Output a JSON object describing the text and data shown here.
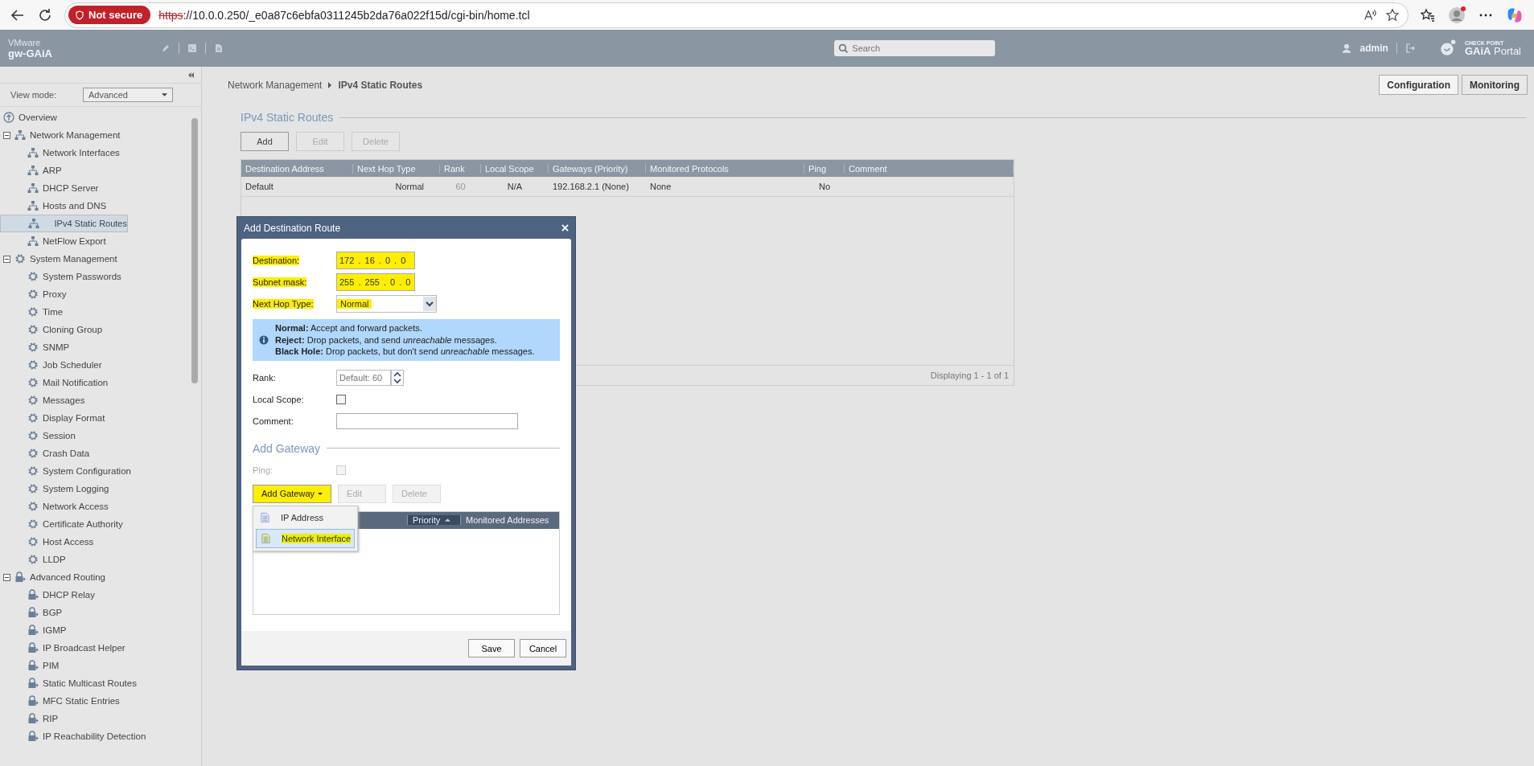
{
  "browser": {
    "security_label": "Not secure",
    "url_scheme": "https",
    "url_rest": "://10.0.0.250/_e0a87c6ebfa0311245b2da76a022f15d/cgi-bin/home.tcl"
  },
  "header": {
    "vendor": "VMware",
    "host": "gw-GAiA",
    "search": {
      "placeholder": "Search"
    },
    "user": "admin",
    "brand_small": "CHECK POINT",
    "brand": "**GAiA** Portal"
  },
  "sidebar": {
    "view_mode_label": "View mode:",
    "view_mode_value": "Advanced",
    "items": [
      {
        "label": "Overview",
        "kind": "overview",
        "selected": false
      },
      {
        "label": "Network Management",
        "kind": "network",
        "selected": false,
        "expanded": true,
        "children": [
          {
            "label": "Network Interfaces",
            "kind": "network",
            "selected": false
          },
          {
            "label": "ARP",
            "kind": "network",
            "selected": false
          },
          {
            "label": "DHCP Server",
            "kind": "network",
            "selected": false
          },
          {
            "label": "Hosts and DNS",
            "kind": "network",
            "selected": false
          },
          {
            "label": "IPv4 Static Routes",
            "kind": "network",
            "selected": true
          },
          {
            "label": "NetFlow Export",
            "kind": "network",
            "selected": false
          }
        ]
      },
      {
        "label": "System Management",
        "kind": "gear",
        "selected": false,
        "expanded": true,
        "children": [
          {
            "label": "System Passwords",
            "kind": "gear",
            "selected": false
          },
          {
            "label": "Proxy",
            "kind": "gear",
            "selected": false
          },
          {
            "label": "Time",
            "kind": "gear",
            "selected": false
          },
          {
            "label": "Cloning Group",
            "kind": "gear",
            "selected": false
          },
          {
            "label": "SNMP",
            "kind": "gear",
            "selected": false
          },
          {
            "label": "Job Scheduler",
            "kind": "gear",
            "selected": false
          },
          {
            "label": "Mail Notification",
            "kind": "gear",
            "selected": false
          },
          {
            "label": "Messages",
            "kind": "gear",
            "selected": false
          },
          {
            "label": "Display Format",
            "kind": "gear",
            "selected": false
          },
          {
            "label": "Session",
            "kind": "gear",
            "selected": false
          },
          {
            "label": "Crash Data",
            "kind": "gear",
            "selected": false
          },
          {
            "label": "System Configuration",
            "kind": "gear",
            "selected": false
          },
          {
            "label": "System Logging",
            "kind": "gear",
            "selected": false
          },
          {
            "label": "Network Access",
            "kind": "gear",
            "selected": false
          },
          {
            "label": "Certificate Authority",
            "kind": "gear",
            "selected": false
          },
          {
            "label": "Host Access",
            "kind": "gear",
            "selected": false
          },
          {
            "label": "LLDP",
            "kind": "gear",
            "selected": false
          }
        ]
      },
      {
        "label": "Advanced Routing",
        "kind": "routing",
        "selected": false,
        "expanded": true,
        "children": [
          {
            "label": "DHCP Relay",
            "kind": "routing",
            "selected": false
          },
          {
            "label": "BGP",
            "kind": "routing",
            "selected": false
          },
          {
            "label": "IGMP",
            "kind": "routing",
            "selected": false
          },
          {
            "label": "IP Broadcast Helper",
            "kind": "routing",
            "selected": false
          },
          {
            "label": "PIM",
            "kind": "routing",
            "selected": false
          },
          {
            "label": "Static Multicast Routes",
            "kind": "routing",
            "selected": false
          },
          {
            "label": "MFC Static Entries",
            "kind": "routing",
            "selected": false
          },
          {
            "label": "RIP",
            "kind": "routing",
            "selected": false
          },
          {
            "label": "IP Reachability Detection",
            "kind": "routing",
            "selected": false
          }
        ]
      }
    ]
  },
  "main": {
    "breadcrumb": [
      "Network Management",
      "IPv4 Static Routes"
    ],
    "modes": [
      {
        "label": "Configuration",
        "selected": true
      },
      {
        "label": "Monitoring",
        "selected": false
      }
    ],
    "section_title": "IPv4 Static Routes",
    "buttons": [
      {
        "label": "Add",
        "disabled": false
      },
      {
        "label": "Edit",
        "disabled": true
      },
      {
        "label": "Delete",
        "disabled": true
      }
    ],
    "table": {
      "columns": [
        "Destination Address",
        "Next Hop Type",
        "Rank",
        "Local Scope",
        "Gateways (Priority)",
        "Monitored Protocols",
        "Ping",
        "Comment"
      ],
      "rows": [
        [
          "Default",
          "Normal",
          "60",
          "N/A",
          "192.168.2.1 (None)",
          "None",
          "No",
          ""
        ]
      ],
      "footer": "Displaying 1 - 1 of 1"
    }
  },
  "dialog": {
    "title": "Add Destination Route",
    "fields": [
      {
        "kind": "ip",
        "label": "Destination:",
        "value": "172 . 16 . 0 . 0",
        "highlighted": true
      },
      {
        "kind": "ip",
        "label": "Subnet mask:",
        "value": "255 . 255 . 0 . 0",
        "highlighted": true
      },
      {
        "kind": "select",
        "label": "Next Hop Type:",
        "value": "Normal",
        "highlighted": true
      },
      {
        "kind": "info",
        "lines": [
          "**Normal:** Accept and forward packets.",
          "**Reject:** Drop packets, and send *unreachable* messages.",
          "**Black Hole:** Drop packets, but don't send *unreachable* messages."
        ]
      },
      {
        "kind": "spinner",
        "label": "Rank:",
        "placeholder": "Default: 60"
      },
      {
        "kind": "checkbox",
        "label": "Local Scope:",
        "checked": false
      },
      {
        "kind": "text",
        "label": "Comment:"
      }
    ],
    "gateway": {
      "title": "Add Gateway",
      "ping": {
        "label": "Ping:",
        "checked": false,
        "disabled": true
      },
      "buttons": [
        {
          "label": "Add Gateway",
          "kind": "dropdown",
          "disabled": false,
          "highlighted": true
        },
        {
          "label": "Edit",
          "kind": "plain",
          "disabled": true,
          "highlighted": false
        },
        {
          "label": "Delete",
          "kind": "plain",
          "disabled": true,
          "highlighted": false
        }
      ],
      "menu": [
        {
          "label": "IP Address",
          "selected": false
        },
        {
          "label": "Network Interface",
          "selected": true
        }
      ],
      "columns": [
        {
          "label": "Priority",
          "sorted": true
        },
        {
          "label": "Monitored Addresses",
          "sorted": false
        }
      ]
    },
    "footer_buttons": [
      "Save",
      "Cancel"
    ]
  }
}
